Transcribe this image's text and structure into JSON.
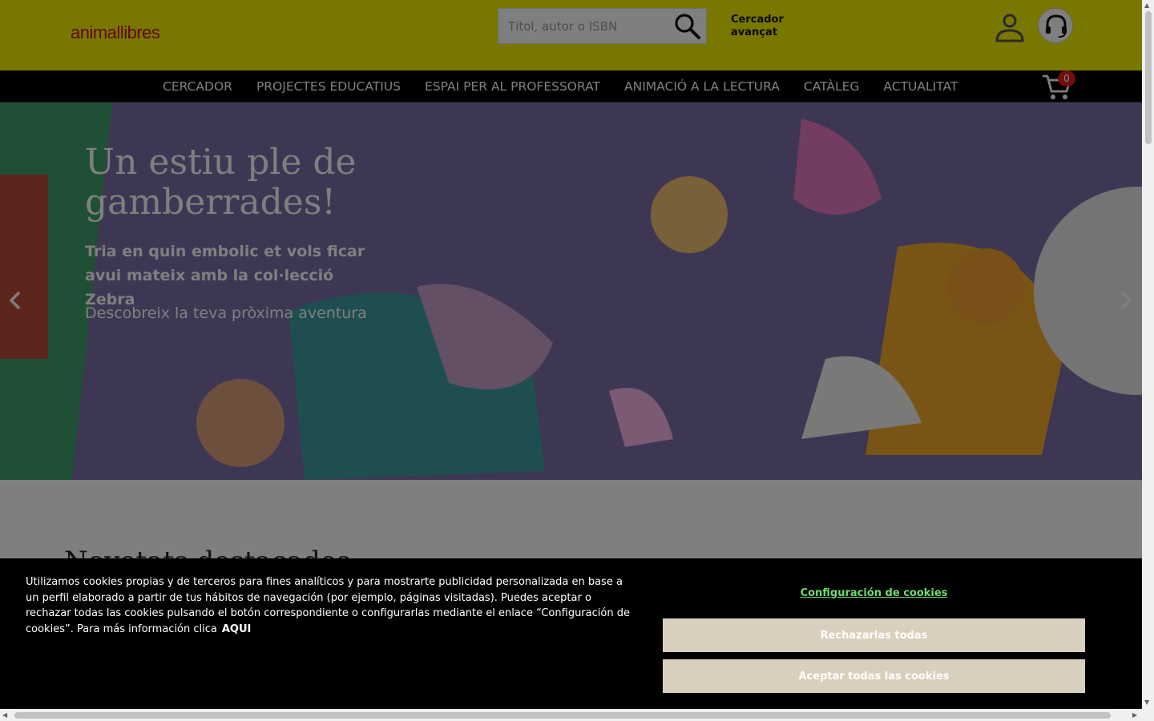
{
  "header": {
    "logo": "animallibres",
    "search_placeholder": "Títol, autor o ISBN",
    "advanced_search": "Cercador avançat"
  },
  "nav": {
    "items": [
      "CERCADOR",
      "PROJECTES EDUCATIUS",
      "ESPAI PER AL PROFESSORAT",
      "ANIMACIÓ A LA LECTURA",
      "CATÀLEG",
      "ACTUALITAT"
    ],
    "cart_count": "0"
  },
  "hero": {
    "title": "Un estiu ple de gamberrades!",
    "subtitle": "Tria en quin embolic et vols ficar avui mateix amb la col·lecció Zebra",
    "cta": "Descobreix la teva pròxima aventura"
  },
  "below": {
    "section_title": "Novetats destacades"
  },
  "cookie": {
    "text": "Utilizamos cookies propias y de terceros para fines analíticos y para mostrarte publicidad personalizada en base a un perfil elaborado a partir de tus hábitos de navegación (por ejemplo, páginas visitadas). Puedes aceptar o rechazar todas las cookies pulsando el botón correspondiente o configurarlas mediante el enlace “Configuración de cookies”. Para más información clica",
    "more_link": "AQUI",
    "config_link": "Configuración de cookies",
    "reject": "Rechazarlas todas",
    "accept": "Aceptar todas las cookies"
  },
  "colors": {
    "header_bg": "#f1f100",
    "nav_bg": "#000000",
    "brand_red": "#c8102e",
    "cookie_button": "#d9cfbe",
    "cookie_link": "#6fdc6f"
  },
  "icons": [
    "search-icon",
    "user-icon",
    "support-icon",
    "cart-icon",
    "chevron-left-icon",
    "chevron-right-icon"
  ]
}
